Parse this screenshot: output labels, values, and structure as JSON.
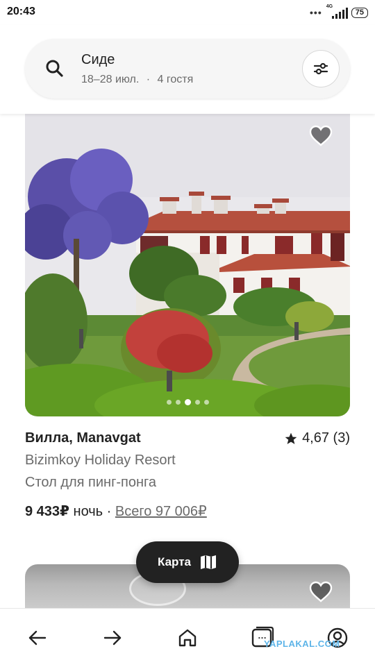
{
  "status_bar": {
    "time": "20:43",
    "dots": "•••",
    "network": "4G",
    "battery": "75"
  },
  "search": {
    "title": "Сиде",
    "dates": "18–28 июл.",
    "separator": "·",
    "guests": "4 гостя",
    "icon": "search-icon",
    "filter_icon": "filter-sliders-icon"
  },
  "listing1": {
    "title": "Вилла, Manavgat",
    "rating": "4,67 (3)",
    "line1": "Bizimkoy Holiday Resort",
    "line2": "Стол для пинг-понга",
    "price": "9 433₽",
    "price_unit": " ночь",
    "sep": " · ",
    "total": "Всего 97 006₽",
    "photo_count": 5,
    "active_photo": 3,
    "favorite_icon": "heart-icon"
  },
  "map_button": {
    "label": "Карта",
    "icon": "map-icon"
  },
  "nav": {
    "back_icon": "arrow-left-icon",
    "forward_icon": "arrow-right-icon",
    "home_icon": "home-icon",
    "tabs_icon": "tabs-icon",
    "tabs_badge": "…",
    "profile_icon": "profile-icon"
  },
  "watermark": "YAPLAKAL.COM",
  "colors": {
    "text": "#222222",
    "secondary": "#6a6a6a",
    "map_button_bg": "#222222",
    "watermark": "#5db4e8"
  }
}
